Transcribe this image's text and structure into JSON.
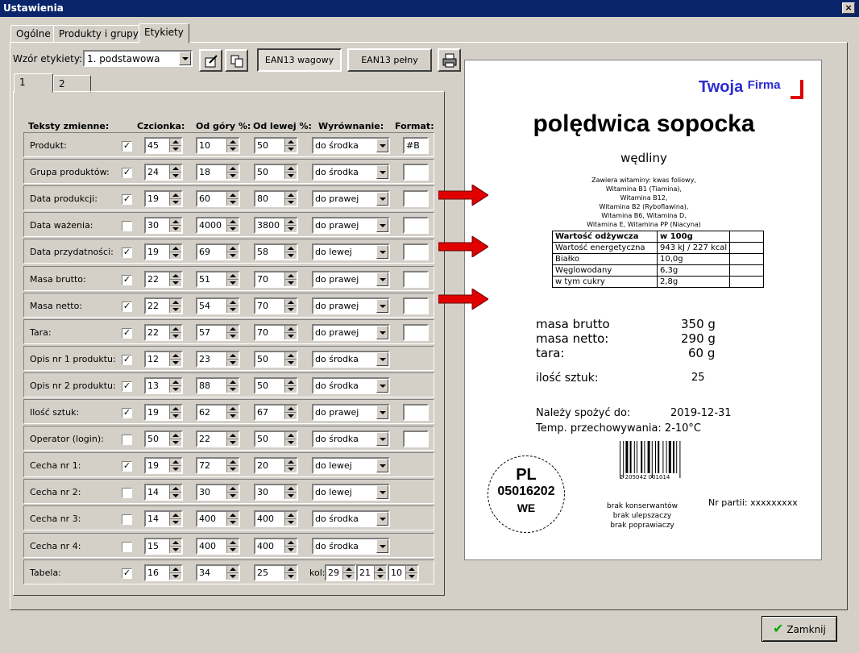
{
  "window": {
    "title": "Ustawienia",
    "close": "×"
  },
  "tabs": [
    "Ogólne",
    "Produkty i grupy",
    "Etykiety"
  ],
  "subtabs": [
    "1",
    "2"
  ],
  "template": {
    "label": "Wzór etykiety:",
    "value": "1. podstawowa"
  },
  "buttons": {
    "ean13w": "EAN13 wagowy",
    "ean13p": "EAN13 pełny",
    "close": "Zamknij"
  },
  "headers": {
    "texts": "Teksty zmienne:",
    "font": "Czcionka:",
    "top": "Od góry %:",
    "left": "Od lewej %:",
    "align": "Wyrównanie:",
    "format": "Format:"
  },
  "rows": [
    {
      "label": "Produkt:",
      "checked": "✓",
      "font": "45",
      "top": "10",
      "left": "50",
      "align": "do środka",
      "format": "#B"
    },
    {
      "label": "Grupa produktów:",
      "checked": "✓",
      "font": "24",
      "top": "18",
      "left": "50",
      "align": "do środka",
      "format": ""
    },
    {
      "label": "Data produkcji:",
      "checked": "✓",
      "font": "19",
      "top": "60",
      "left": "80",
      "align": "do prawej",
      "format": ""
    },
    {
      "label": "Data ważenia:",
      "checked": "",
      "font": "30",
      "top": "4000",
      "left": "3800",
      "align": "do prawej",
      "format": ""
    },
    {
      "label": "Data przydatności:",
      "checked": "✓",
      "font": "19",
      "top": "69",
      "left": "58",
      "align": "do lewej",
      "format": ""
    },
    {
      "label": "Masa brutto:",
      "checked": "✓",
      "font": "22",
      "top": "51",
      "left": "70",
      "align": "do prawej",
      "format": ""
    },
    {
      "label": "Masa netto:",
      "checked": "✓",
      "font": "22",
      "top": "54",
      "left": "70",
      "align": "do prawej",
      "format": ""
    },
    {
      "label": "Tara:",
      "checked": "✓",
      "font": "22",
      "top": "57",
      "left": "70",
      "align": "do prawej",
      "format": ""
    },
    {
      "label": "Opis nr 1 produktu:",
      "checked": "✓",
      "font": "12",
      "top": "23",
      "left": "50",
      "align": "do środka"
    },
    {
      "label": "Opis nr 2 produktu:",
      "checked": "✓",
      "font": "13",
      "top": "88",
      "left": "50",
      "align": "do środka"
    },
    {
      "label": "Ilość sztuk:",
      "checked": "✓",
      "font": "19",
      "top": "62",
      "left": "67",
      "align": "do prawej",
      "format": ""
    },
    {
      "label": "Operator (login):",
      "checked": "",
      "font": "50",
      "top": "22",
      "left": "50",
      "align": "do środka",
      "format": ""
    },
    {
      "label": "Cecha nr 1:",
      "checked": "✓",
      "font": "19",
      "top": "72",
      "left": "20",
      "align": "do lewej"
    },
    {
      "label": "Cecha nr 2:",
      "checked": "",
      "font": "14",
      "top": "30",
      "left": "30",
      "align": "do lewej"
    },
    {
      "label": "Cecha nr 3:",
      "checked": "",
      "font": "14",
      "top": "400",
      "left": "400",
      "align": "do środka"
    },
    {
      "label": "Cecha nr 4:",
      "checked": "",
      "font": "15",
      "top": "400",
      "left": "400",
      "align": "do środka"
    },
    {
      "label": "Tabela:",
      "checked": "✓",
      "font": "16",
      "top": "34",
      "left": "25",
      "kol_label": "kol:",
      "kol": [
        "29",
        "21",
        "10"
      ]
    }
  ],
  "preview": {
    "brand1": "Twoja",
    "brand2": "Firma",
    "product": "polędwica sopocka",
    "group": "wędliny",
    "vitamins": [
      "Zawiera witaminy: kwas foliowy,",
      "Witamina B1 (Tiamina),",
      "Witamina B12,",
      "Witamina B2 (Ryboflawina),",
      "Witamina B6, Witamina D,",
      "Witamina E, Witamina PP (Niacyna)"
    ],
    "nutrition": [
      [
        "Wartość odżywcza",
        "w 100g",
        ""
      ],
      [
        "Wartość energetyczna",
        "943 kJ / 227 kcal",
        ""
      ],
      [
        "Białko",
        "10,0g",
        ""
      ],
      [
        "Węglowodany",
        "6,3g",
        ""
      ],
      [
        "w tym cukry",
        "2,8g",
        ""
      ]
    ],
    "mass_brutto_label": "masa brutto",
    "mass_brutto": "350 g",
    "mass_netto_label": "masa netto:",
    "mass_netto": "290 g",
    "tara_label": "tara:",
    "tara": "60 g",
    "qty_label": "ilość sztuk:",
    "qty": "25",
    "exp_label": "Należy spożyć do:",
    "exp": "2019-12-31",
    "temp": "Temp. przechowywania: 2-10°C",
    "barcode_text": "2 205042 001014",
    "stamp": [
      "PL",
      "05016202",
      "WE"
    ],
    "batch": "Nr partii: xxxxxxxxx",
    "notes": [
      "brak konserwantów",
      "brak ulepszaczy",
      "brak poprawiaczy"
    ]
  }
}
